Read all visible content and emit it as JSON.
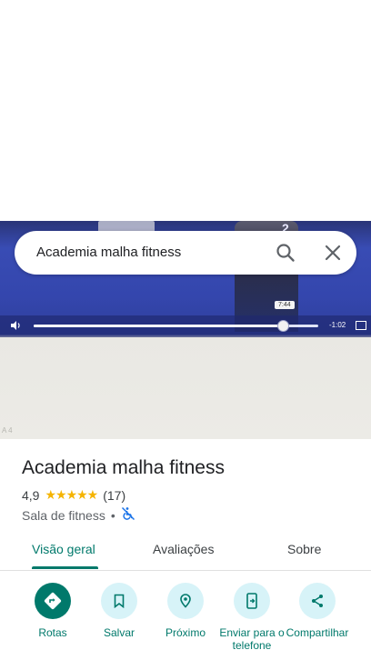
{
  "search": {
    "query": "Academia malha fitness"
  },
  "video": {
    "tooltip_time": "7:44",
    "remaining_time": "-1:02",
    "progress": 0.87,
    "corner_mark": "A 4"
  },
  "place": {
    "name": "Academia malha fitness",
    "rating": "4,9",
    "stars": "★★★★★",
    "review_count": "(17)",
    "category": "Sala de fitness",
    "separator": "•"
  },
  "tabs": [
    {
      "label": "Visão geral",
      "active": true
    },
    {
      "label": "Avaliações",
      "active": false
    },
    {
      "label": "Sobre",
      "active": false
    }
  ],
  "actions": [
    {
      "label": "Rotas",
      "icon": "directions-icon"
    },
    {
      "label": "Salvar",
      "icon": "bookmark-icon"
    },
    {
      "label": "Próximo",
      "icon": "nearby-icon"
    },
    {
      "label": "Enviar para o telefone",
      "icon": "send-to-phone-icon"
    },
    {
      "label": "Compartilhar",
      "icon": "share-icon"
    }
  ],
  "colors": {
    "accent": "#00796b",
    "action_bg": "#d7f3f8",
    "star": "#f5b400"
  }
}
